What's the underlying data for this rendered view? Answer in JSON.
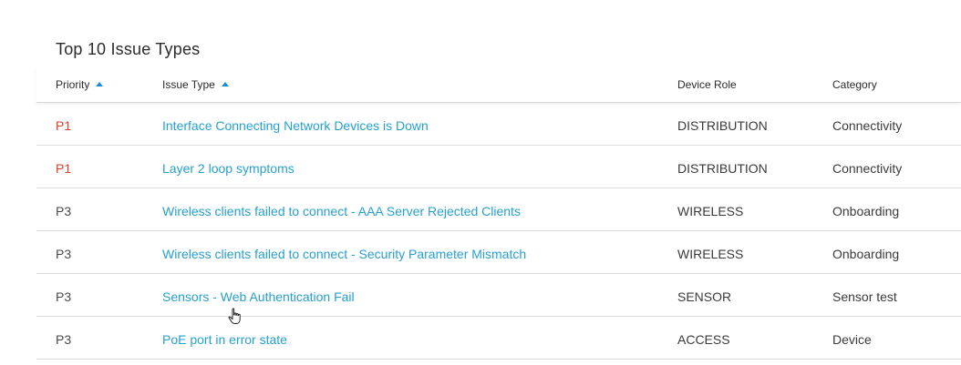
{
  "panel": {
    "title": "Top 10 Issue Types"
  },
  "columns": {
    "priority": "Priority",
    "issue_type": "Issue Type",
    "device_role": "Device Role",
    "category": "Category"
  },
  "rows": [
    {
      "priority": "P1",
      "issue_type": "Interface Connecting Network Devices is Down",
      "device_role": "DISTRIBUTION",
      "category": "Connectivity"
    },
    {
      "priority": "P1",
      "issue_type": "Layer 2 loop symptoms",
      "device_role": "DISTRIBUTION",
      "category": "Connectivity"
    },
    {
      "priority": "P3",
      "issue_type": "Wireless clients failed to connect - AAA Server Rejected Clients",
      "device_role": "WIRELESS",
      "category": "Onboarding"
    },
    {
      "priority": "P3",
      "issue_type": "Wireless clients failed to connect - Security Parameter Mismatch",
      "device_role": "WIRELESS",
      "category": "Onboarding"
    },
    {
      "priority": "P3",
      "issue_type": "Sensors - Web Authentication Fail",
      "device_role": "SENSOR",
      "category": "Sensor test"
    },
    {
      "priority": "P3",
      "issue_type": "PoE port in error state",
      "device_role": "ACCESS",
      "category": "Device"
    }
  ],
  "colors": {
    "p1": "#d2452f",
    "p3": "#4a4a4a",
    "link": "#27a0cf",
    "sort_arrow": "#1f8bd0"
  },
  "icons": {
    "sort": "sort-ascending-icon",
    "cursor": "hand-pointer-icon"
  }
}
